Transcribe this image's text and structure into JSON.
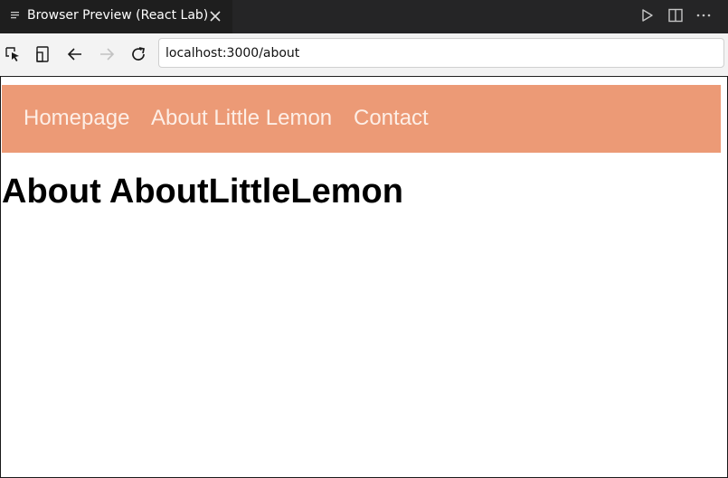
{
  "tab": {
    "title": "Browser Preview (React Lab)",
    "icon": "preview-lines-icon",
    "close_icon": "close-icon"
  },
  "window_actions": {
    "run_icon": "play-icon",
    "split_icon": "split-editor-icon",
    "more_icon": "more-icon"
  },
  "toolbar": {
    "inspect_icon": "inspect-icon",
    "device_icon": "device-toggle-icon",
    "back_icon": "back-arrow-icon",
    "forward_icon": "forward-arrow-icon",
    "reload_icon": "reload-icon",
    "address_value": "localhost:3000/about"
  },
  "page": {
    "nav_links": [
      {
        "label": "Homepage"
      },
      {
        "label": "About Little Lemon"
      },
      {
        "label": "Contact"
      }
    ],
    "heading": "About AboutLittleLemon"
  },
  "colors": {
    "nav_background": "#ec9a76",
    "nav_text": "#fdeee6",
    "tab_bar": "#252526",
    "active_tab": "#1e1e1e"
  }
}
